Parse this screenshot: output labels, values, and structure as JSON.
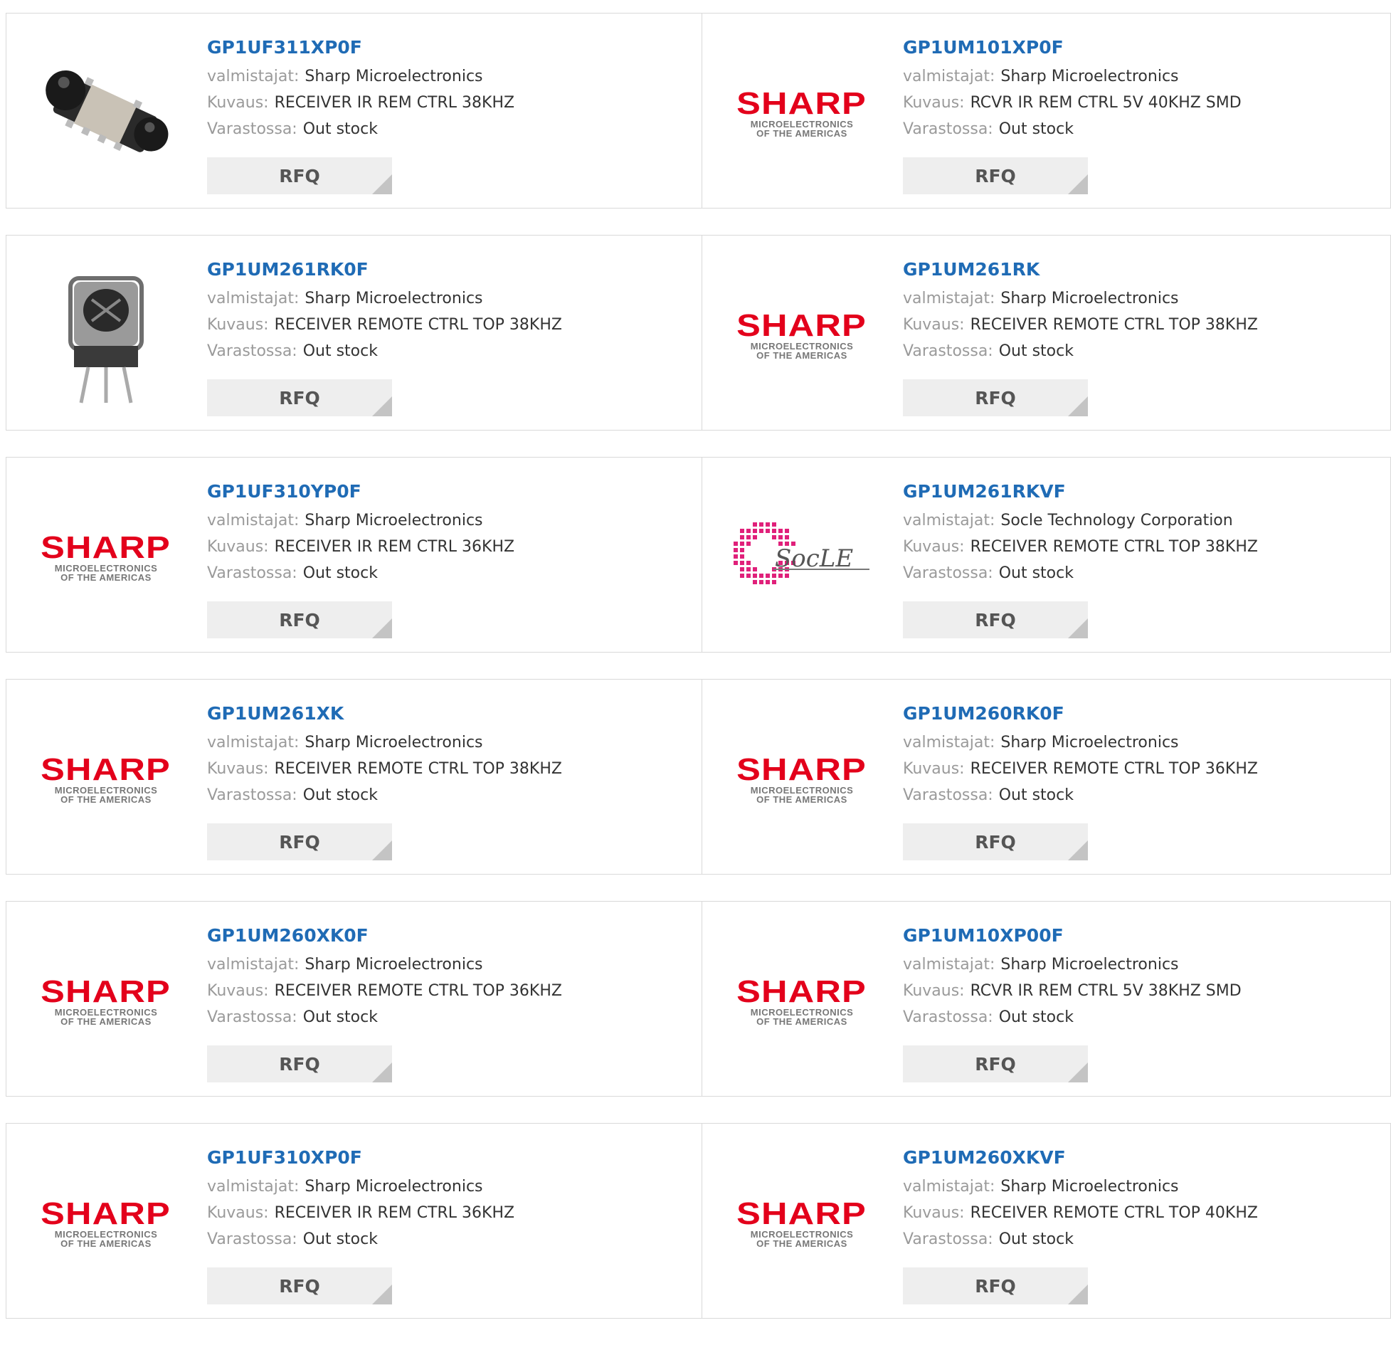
{
  "labels": {
    "manufacturer": "valmistajat:",
    "description": "Kuvaus:",
    "stock": "Varastossa:",
    "rfq": "RFQ"
  },
  "logos": {
    "sharp_word": "SHARP",
    "sharp_sub1": "MICROELECTRONICS",
    "sharp_sub2": "OF THE AMERICAS",
    "socle_word": "SocLE"
  },
  "colors": {
    "part_link": "#1f6bb5",
    "sharp_red": "#e3001b",
    "socle_pink": "#e0207a"
  },
  "products": [
    {
      "part": "GP1UF311XP0F",
      "manufacturer": "Sharp Microelectronics",
      "description": "RECEIVER IR REM CTRL 38KHZ",
      "stock": "Out stock",
      "image": "ir-receiver-smd-photo"
    },
    {
      "part": "GP1UM101XP0F",
      "manufacturer": "Sharp Microelectronics",
      "description": "RCVR IR REM CTRL 5V 40KHZ SMD",
      "stock": "Out stock",
      "image": "sharp-logo"
    },
    {
      "part": "GP1UM261RK0F",
      "manufacturer": "Sharp Microelectronics",
      "description": "RECEIVER REMOTE CTRL TOP 38KHZ",
      "stock": "Out stock",
      "image": "ir-receiver-through-hole-photo"
    },
    {
      "part": "GP1UM261RK",
      "manufacturer": "Sharp Microelectronics",
      "description": "RECEIVER REMOTE CTRL TOP 38KHZ",
      "stock": "Out stock",
      "image": "sharp-logo"
    },
    {
      "part": "GP1UF310YP0F",
      "manufacturer": "Sharp Microelectronics",
      "description": "RECEIVER IR REM CTRL 36KHZ",
      "stock": "Out stock",
      "image": "sharp-logo"
    },
    {
      "part": "GP1UM261RKVF",
      "manufacturer": "Socle Technology Corporation",
      "description": "RECEIVER REMOTE CTRL TOP 38KHZ",
      "stock": "Out stock",
      "image": "socle-logo"
    },
    {
      "part": "GP1UM261XK",
      "manufacturer": "Sharp Microelectronics",
      "description": "RECEIVER REMOTE CTRL TOP 38KHZ",
      "stock": "Out stock",
      "image": "sharp-logo"
    },
    {
      "part": "GP1UM260RK0F",
      "manufacturer": "Sharp Microelectronics",
      "description": "RECEIVER REMOTE CTRL TOP 36KHZ",
      "stock": "Out stock",
      "image": "sharp-logo"
    },
    {
      "part": "GP1UM260XK0F",
      "manufacturer": "Sharp Microelectronics",
      "description": "RECEIVER REMOTE CTRL TOP 36KHZ",
      "stock": "Out stock",
      "image": "sharp-logo"
    },
    {
      "part": "GP1UM10XP00F",
      "manufacturer": "Sharp Microelectronics",
      "description": "RCVR IR REM CTRL 5V 38KHZ SMD",
      "stock": "Out stock",
      "image": "sharp-logo"
    },
    {
      "part": "GP1UF310XP0F",
      "manufacturer": "Sharp Microelectronics",
      "description": "RECEIVER IR REM CTRL 36KHZ",
      "stock": "Out stock",
      "image": "sharp-logo"
    },
    {
      "part": "GP1UM260XKVF",
      "manufacturer": "Sharp Microelectronics",
      "description": "RECEIVER REMOTE CTRL TOP 40KHZ",
      "stock": "Out stock",
      "image": "sharp-logo"
    }
  ]
}
